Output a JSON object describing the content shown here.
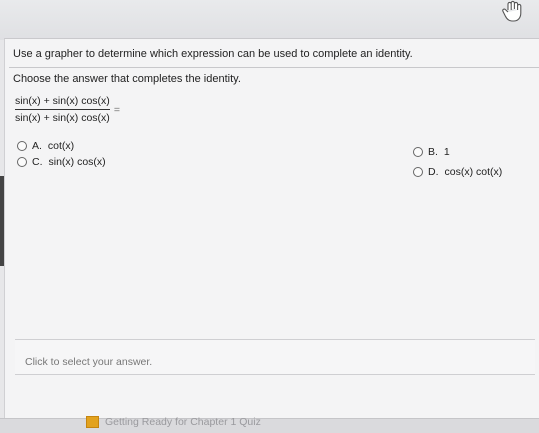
{
  "question": {
    "instruction": "Use a grapher to determine which expression can be used to complete an identity.",
    "prompt": "Choose the answer that completes the identity.",
    "fraction": {
      "numerator": "sin(x) + sin(x) cos(x)",
      "denominator": "sin(x) + sin(x) cos(x)",
      "equals": "="
    }
  },
  "options": [
    {
      "letter": "A.",
      "text": "cot(x)"
    },
    {
      "letter": "B.",
      "text": "1"
    },
    {
      "letter": "C.",
      "text": "sin(x) cos(x)"
    },
    {
      "letter": "D.",
      "text": "cos(x) cot(x)"
    }
  ],
  "answer_area": {
    "label": "Click to select your answer."
  },
  "footer": {
    "quiz_link": "Getting Ready for Chapter 1 Quiz"
  },
  "icons": {
    "cursor": "hand-pointer-icon",
    "quiz": "quiz-square-icon"
  },
  "colors": {
    "quiz_icon": "#e2a21e"
  }
}
